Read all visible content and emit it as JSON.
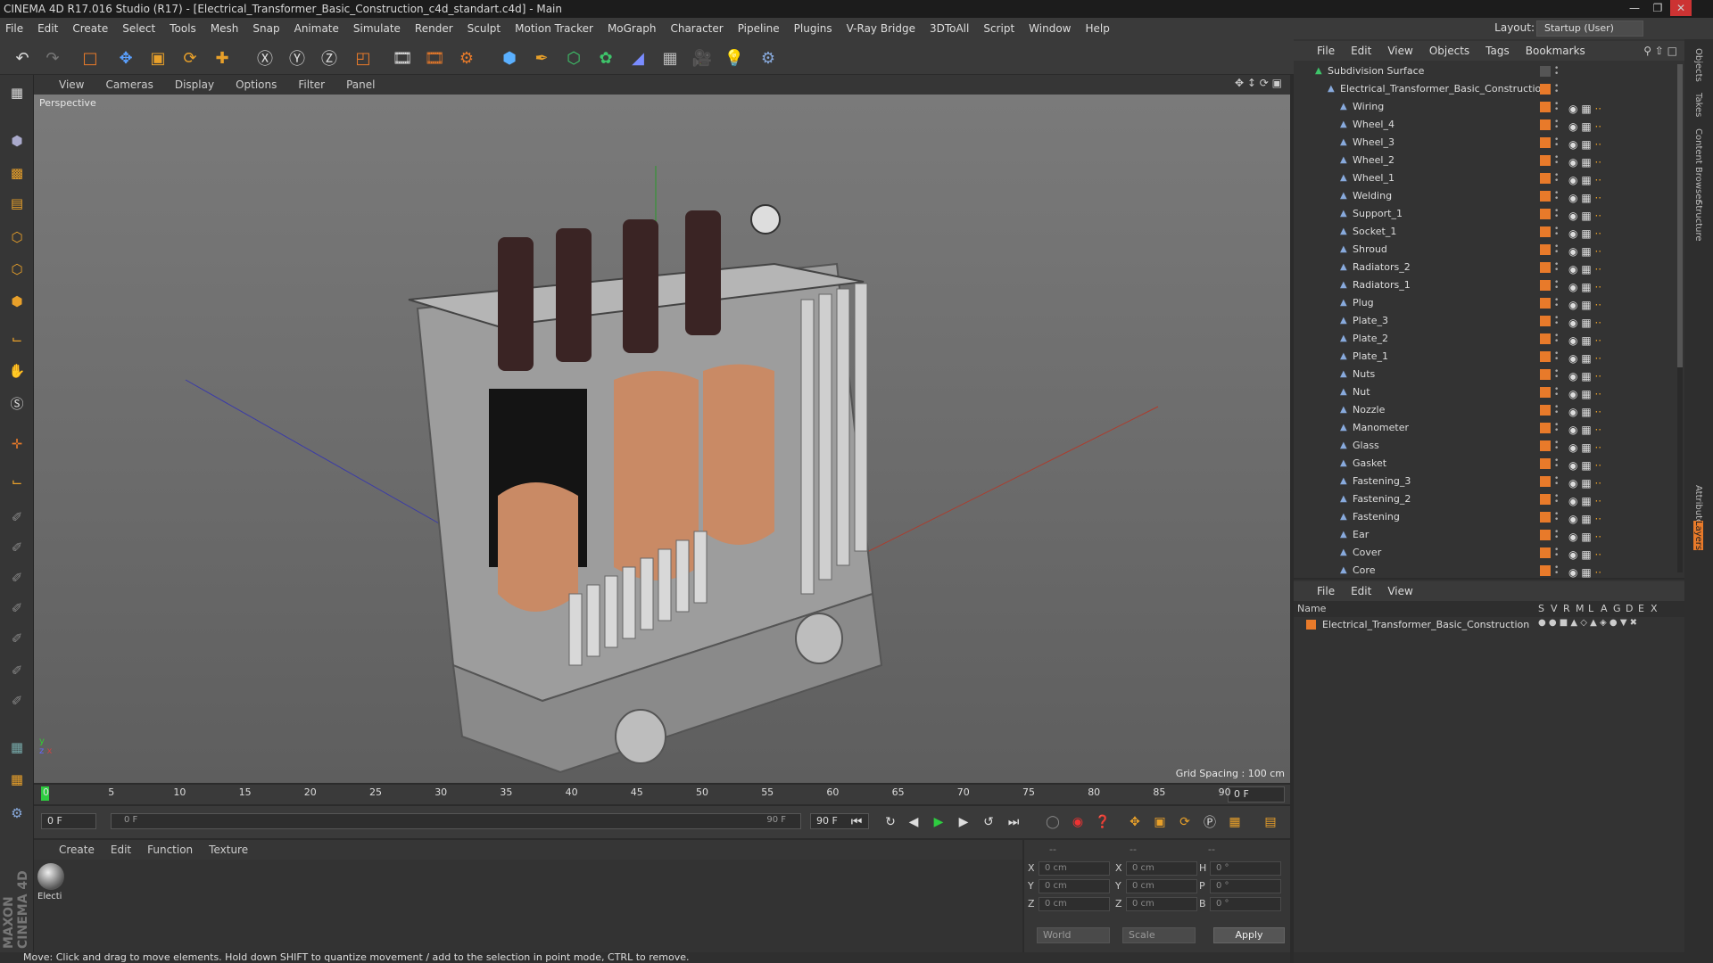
{
  "window": {
    "title": "CINEMA 4D R17.016 Studio (R17) - [Electrical_Transformer_Basic_Construction_c4d_standart.c4d] - Main"
  },
  "menubar": {
    "items": [
      "File",
      "Edit",
      "Create",
      "Select",
      "Tools",
      "Mesh",
      "Snap",
      "Animate",
      "Simulate",
      "Render",
      "Sculpt",
      "Motion Tracker",
      "MoGraph",
      "Character",
      "Pipeline",
      "Plugins",
      "V-Ray Bridge",
      "3DToAll",
      "Script",
      "Window",
      "Help"
    ]
  },
  "layout": {
    "label": "Layout:",
    "value": "Startup (User)"
  },
  "viewport": {
    "menu": [
      "View",
      "Cameras",
      "Display",
      "Options",
      "Filter",
      "Panel"
    ],
    "label": "Perspective",
    "grid_spacing": "Grid Spacing : 100 cm"
  },
  "timeline": {
    "ticks": [
      "0",
      "5",
      "10",
      "15",
      "20",
      "25",
      "30",
      "35",
      "40",
      "45",
      "50",
      "55",
      "60",
      "65",
      "70",
      "75",
      "80",
      "85",
      "90"
    ],
    "current_frame": "0 F",
    "start_frame": "0 F",
    "range_start": "0 F",
    "range_end": "90 F",
    "end_frame": "90 F"
  },
  "material_manager": {
    "menu": [
      "Create",
      "Edit",
      "Function",
      "Texture"
    ],
    "materials": [
      {
        "name": "Electi"
      }
    ]
  },
  "coordinates": {
    "headers": [
      "--",
      "--",
      "--"
    ],
    "rows": [
      {
        "a": "X",
        "av": "0 cm",
        "b": "X",
        "bv": "0 cm",
        "c": "H",
        "cv": "0 °"
      },
      {
        "a": "Y",
        "av": "0 cm",
        "b": "Y",
        "bv": "0 cm",
        "c": "P",
        "cv": "0 °"
      },
      {
        "a": "Z",
        "av": "0 cm",
        "b": "Z",
        "bv": "0 cm",
        "c": "B",
        "cv": "0 °"
      }
    ],
    "mode": "World",
    "type": "Scale",
    "apply": "Apply"
  },
  "status": {
    "text": "Move: Click and drag to move elements. Hold down SHIFT to quantize movement / add to the selection in point mode, CTRL to remove."
  },
  "object_manager": {
    "menu": [
      "File",
      "Edit",
      "View",
      "Objects",
      "Tags",
      "Bookmarks"
    ],
    "root": "Subdivision Surface",
    "group": "Electrical_Transformer_Basic_Construction",
    "objects": [
      "Wiring",
      "Wheel_4",
      "Wheel_3",
      "Wheel_2",
      "Wheel_1",
      "Welding",
      "Support_1",
      "Socket_1",
      "Shroud",
      "Radiators_2",
      "Radiators_1",
      "Plug",
      "Plate_3",
      "Plate_2",
      "Plate_1",
      "Nuts",
      "Nut",
      "Nozzle",
      "Manometer",
      "Glass",
      "Gasket",
      "Fastening_3",
      "Fastening_2",
      "Fastening",
      "Ear",
      "Cover",
      "Core"
    ]
  },
  "layer_manager": {
    "menu": [
      "File",
      "Edit",
      "View"
    ],
    "columns": [
      "Name",
      "S",
      "V",
      "R",
      "M",
      "L",
      "A",
      "G",
      "D",
      "E",
      "X"
    ],
    "layers": [
      {
        "name": "Electrical_Transformer_Basic_Construction",
        "color": "#e87a2a"
      }
    ]
  },
  "right_tabs": [
    "Objects",
    "Takes",
    "Content Browser",
    "Structure",
    "Attributes",
    "Layers"
  ],
  "colors": {
    "accent": "#e87a2a",
    "play": "#2ecc40"
  },
  "brand": "MAXON CINEMA 4D"
}
